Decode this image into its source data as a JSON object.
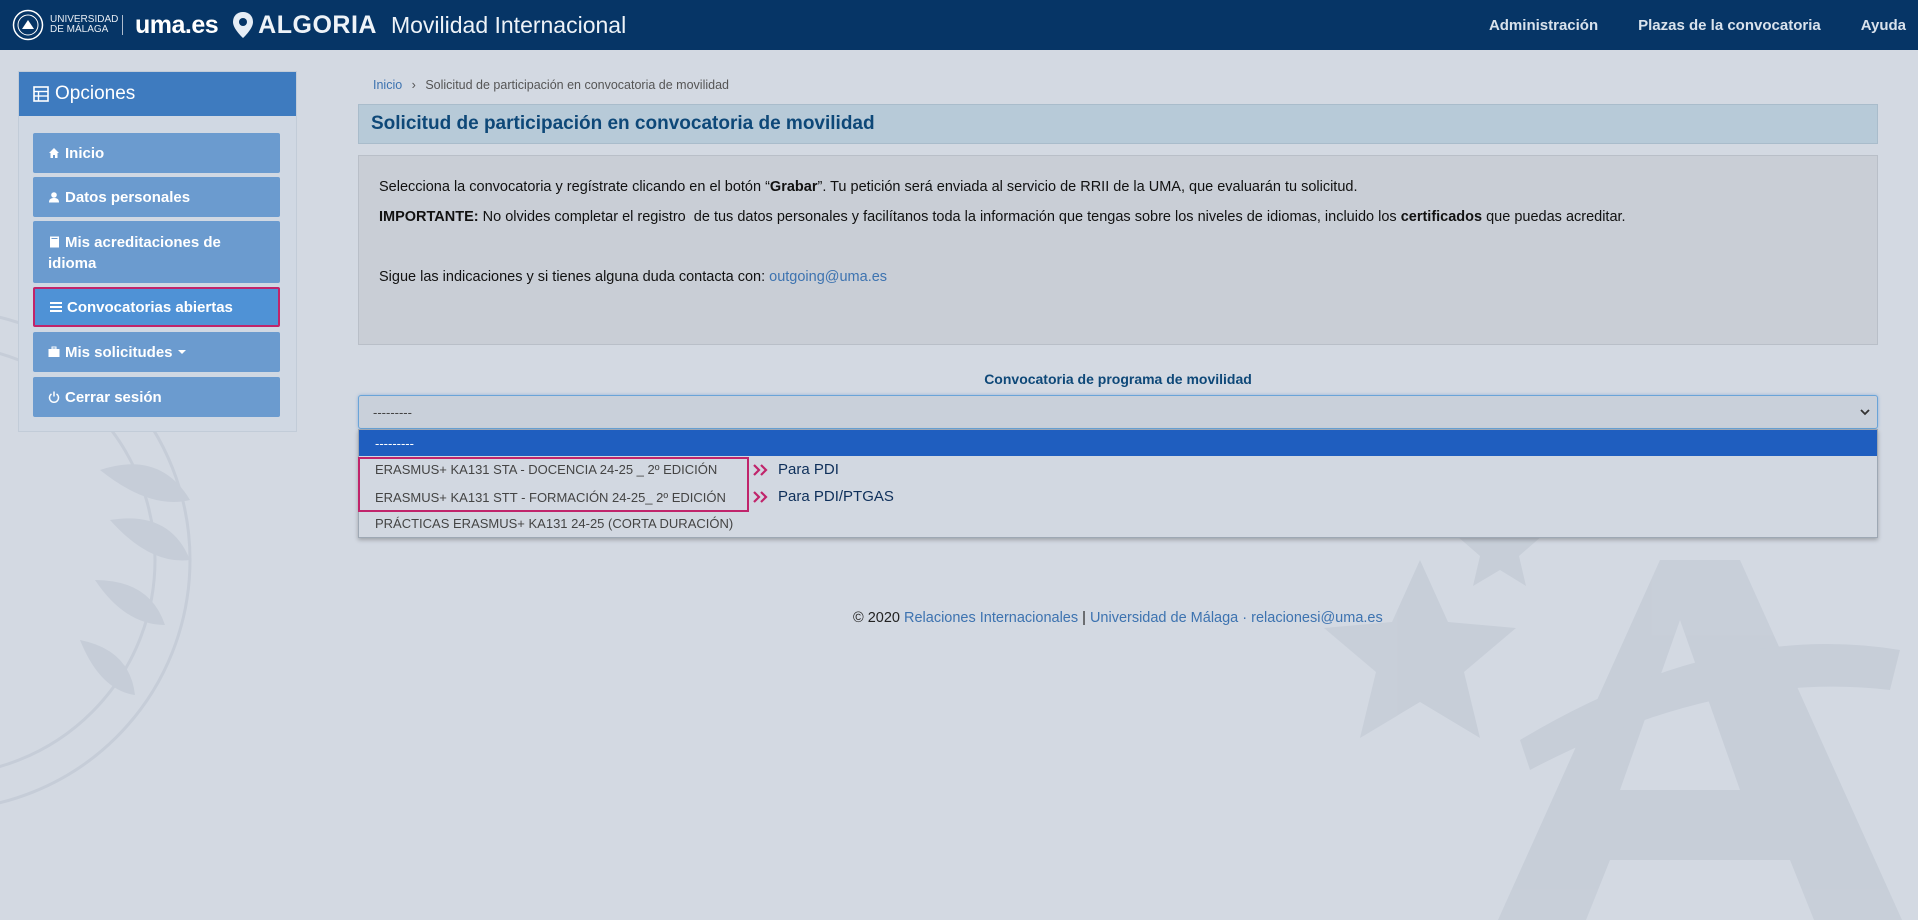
{
  "header": {
    "university_line1": "UNIVERSIDAD",
    "university_line2": "DE MÁLAGA",
    "uma_logo": "uma.es",
    "algoria_logo": "ALGORIA",
    "app_title": "Movilidad Internacional",
    "nav": [
      {
        "label": "Administración"
      },
      {
        "label": "Plazas de la convocatoria"
      },
      {
        "label": "Ayuda"
      }
    ]
  },
  "sidebar": {
    "title": "Opciones",
    "items": [
      {
        "label": "Inicio",
        "icon": "home-icon"
      },
      {
        "label": "Datos personales",
        "icon": "user-icon"
      },
      {
        "label": "Mis acreditaciones de idioma",
        "icon": "book-icon"
      },
      {
        "label": "Convocatorias abiertas",
        "icon": "list-icon",
        "active": true
      },
      {
        "label": "Mis solicitudes",
        "icon": "briefcase-icon"
      },
      {
        "label": "Cerrar sesión",
        "icon": "power-icon"
      }
    ]
  },
  "breadcrumb": {
    "home": "Inicio",
    "current": "Solicitud de participación en convocatoria de movilidad"
  },
  "page": {
    "title": "Solicitud de participación en convocatoria de movilidad",
    "info": {
      "p1_before": "Selecciona la convocatoria y regístrate clicando en el botón “",
      "p1_bold": "Grabar",
      "p1_after": "”. Tu petición será enviada al servicio de RRII de la UMA, que evaluarán tu solicitud.",
      "p2_bold": "IMPORTANTE:",
      "p2_text": " No olvides completar el registro  de tus datos personales y facilítanos toda la información que tengas sobre los niveles de idiomas, incluido los ",
      "p2_bold2": "certificados",
      "p2_after": " que puedas acreditar.",
      "p3_text": "Sigue las indicaciones y si tienes alguna duda contacta con: ",
      "p3_link": "outgoing@uma.es"
    },
    "select": {
      "label": "Convocatoria de programa de movilidad",
      "value": "---------",
      "options": [
        "---------",
        "ERASMUS+ KA131 STA - DOCENCIA 24-25 _ 2º EDICIÓN",
        "ERASMUS+ KA131 STT - FORMACIÓN 24-25_ 2º EDICIÓN",
        "PRÁCTICAS ERASMUS+ KA131 24-25 (CORTA DURACIÓN)"
      ]
    },
    "annotations": [
      "Para PDI",
      "Para PDI/PTGAS"
    ]
  },
  "footer": {
    "copyright": "© 2020 ",
    "link1": "Relaciones Internacionales",
    "sep": " | ",
    "link2": "Universidad de Málaga",
    "dot": " · ",
    "link3": "relacionesi@uma.es"
  },
  "colors": {
    "navbar": "#063566",
    "sidebar_header": "#3e7bbf",
    "sidebar_item": "#6b9bcf",
    "highlight": "#c0246b",
    "selected_option": "#1f5ebf"
  }
}
